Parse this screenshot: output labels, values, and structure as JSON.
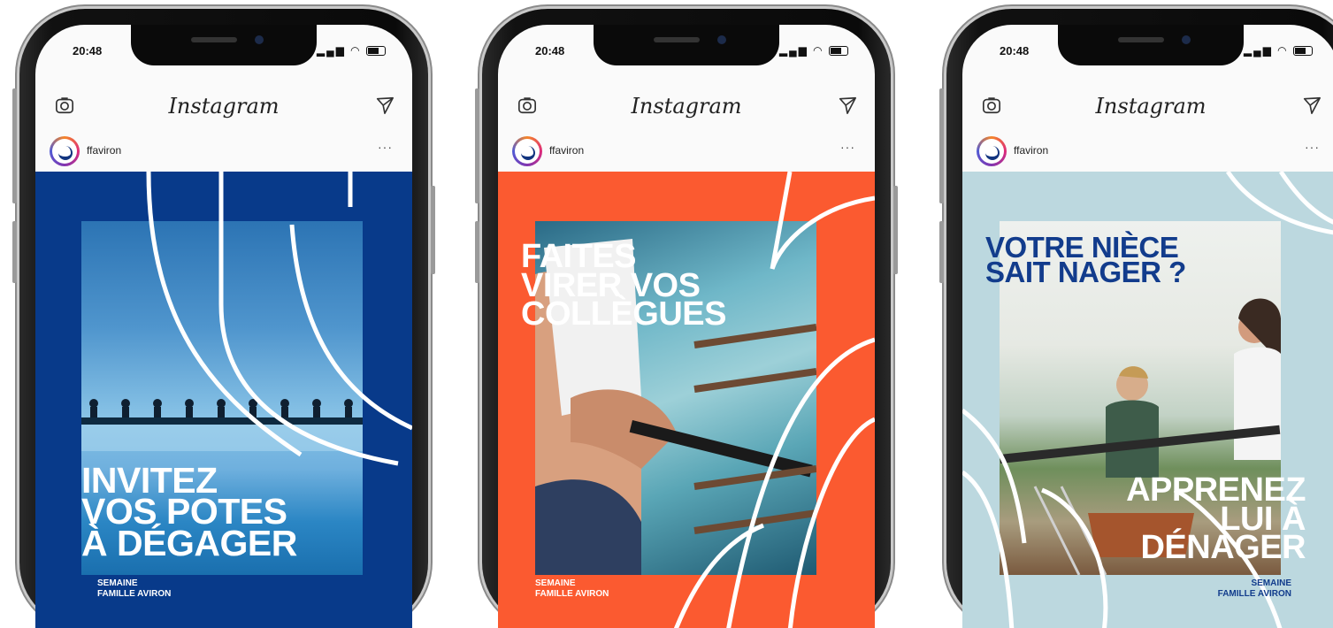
{
  "phones": [
    {
      "status_time": "20:48",
      "app_title": "Instagram",
      "account": "ffaviron",
      "more": "···",
      "headline": [
        "INVITEZ",
        "VOS POTES",
        "À DÉGAGER"
      ],
      "footer": [
        "SEMAINE",
        "FAMILLE AVIRON"
      ],
      "bg_color": "#083a8a",
      "headline_color": "#ffffff",
      "footer_color": "#ffffff"
    },
    {
      "status_time": "20:48",
      "app_title": "Instagram",
      "account": "ffaviron",
      "more": "···",
      "headline": [
        "FAITES",
        "VIRER VOS",
        "COLLÈGUES"
      ],
      "footer": [
        "SEMAINE",
        "FAMILLE AVIRON"
      ],
      "bg_color": "#fb5a30",
      "headline_color": "#ffffff",
      "footer_color": "#ffffff"
    },
    {
      "status_time": "20:48",
      "app_title": "Instagram",
      "account": "ffaviron",
      "more": "···",
      "headline_top": [
        "VOTRE NIÈCE",
        "SAIT NAGER ?"
      ],
      "headline": [
        "APPRENEZ",
        "LUI À",
        "DÉNAGER"
      ],
      "footer": [
        "SEMAINE",
        "FAMILLE AVIRON"
      ],
      "bg_color": "#bcd8df",
      "headline_color": "#ffffff",
      "headline_top_color": "#123c8c",
      "footer_color": "#123c8c"
    }
  ],
  "icons": {
    "camera": "camera-icon",
    "send": "paper-plane-icon",
    "wifi": "wifi-icon",
    "battery": "battery-icon",
    "signal": "signal-icon",
    "location": "location-arrow-icon"
  }
}
